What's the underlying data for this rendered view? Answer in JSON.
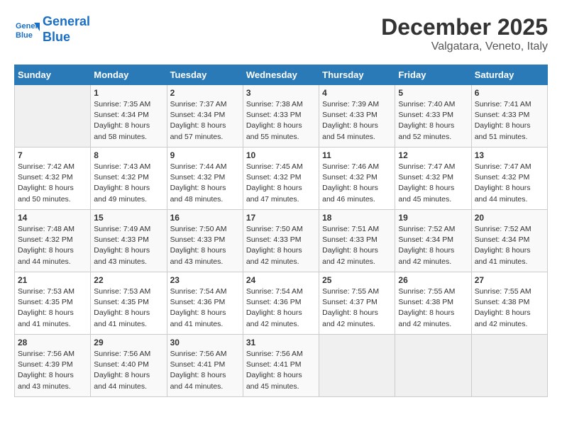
{
  "header": {
    "logo_line1": "General",
    "logo_line2": "Blue",
    "month": "December 2025",
    "location": "Valgatara, Veneto, Italy"
  },
  "weekdays": [
    "Sunday",
    "Monday",
    "Tuesday",
    "Wednesday",
    "Thursday",
    "Friday",
    "Saturday"
  ],
  "weeks": [
    [
      {
        "day": "",
        "sunrise": "",
        "sunset": "",
        "daylight": ""
      },
      {
        "day": "1",
        "sunrise": "Sunrise: 7:35 AM",
        "sunset": "Sunset: 4:34 PM",
        "daylight": "Daylight: 8 hours and 58 minutes."
      },
      {
        "day": "2",
        "sunrise": "Sunrise: 7:37 AM",
        "sunset": "Sunset: 4:34 PM",
        "daylight": "Daylight: 8 hours and 57 minutes."
      },
      {
        "day": "3",
        "sunrise": "Sunrise: 7:38 AM",
        "sunset": "Sunset: 4:33 PM",
        "daylight": "Daylight: 8 hours and 55 minutes."
      },
      {
        "day": "4",
        "sunrise": "Sunrise: 7:39 AM",
        "sunset": "Sunset: 4:33 PM",
        "daylight": "Daylight: 8 hours and 54 minutes."
      },
      {
        "day": "5",
        "sunrise": "Sunrise: 7:40 AM",
        "sunset": "Sunset: 4:33 PM",
        "daylight": "Daylight: 8 hours and 52 minutes."
      },
      {
        "day": "6",
        "sunrise": "Sunrise: 7:41 AM",
        "sunset": "Sunset: 4:33 PM",
        "daylight": "Daylight: 8 hours and 51 minutes."
      }
    ],
    [
      {
        "day": "7",
        "sunrise": "Sunrise: 7:42 AM",
        "sunset": "Sunset: 4:32 PM",
        "daylight": "Daylight: 8 hours and 50 minutes."
      },
      {
        "day": "8",
        "sunrise": "Sunrise: 7:43 AM",
        "sunset": "Sunset: 4:32 PM",
        "daylight": "Daylight: 8 hours and 49 minutes."
      },
      {
        "day": "9",
        "sunrise": "Sunrise: 7:44 AM",
        "sunset": "Sunset: 4:32 PM",
        "daylight": "Daylight: 8 hours and 48 minutes."
      },
      {
        "day": "10",
        "sunrise": "Sunrise: 7:45 AM",
        "sunset": "Sunset: 4:32 PM",
        "daylight": "Daylight: 8 hours and 47 minutes."
      },
      {
        "day": "11",
        "sunrise": "Sunrise: 7:46 AM",
        "sunset": "Sunset: 4:32 PM",
        "daylight": "Daylight: 8 hours and 46 minutes."
      },
      {
        "day": "12",
        "sunrise": "Sunrise: 7:47 AM",
        "sunset": "Sunset: 4:32 PM",
        "daylight": "Daylight: 8 hours and 45 minutes."
      },
      {
        "day": "13",
        "sunrise": "Sunrise: 7:47 AM",
        "sunset": "Sunset: 4:32 PM",
        "daylight": "Daylight: 8 hours and 44 minutes."
      }
    ],
    [
      {
        "day": "14",
        "sunrise": "Sunrise: 7:48 AM",
        "sunset": "Sunset: 4:32 PM",
        "daylight": "Daylight: 8 hours and 44 minutes."
      },
      {
        "day": "15",
        "sunrise": "Sunrise: 7:49 AM",
        "sunset": "Sunset: 4:33 PM",
        "daylight": "Daylight: 8 hours and 43 minutes."
      },
      {
        "day": "16",
        "sunrise": "Sunrise: 7:50 AM",
        "sunset": "Sunset: 4:33 PM",
        "daylight": "Daylight: 8 hours and 43 minutes."
      },
      {
        "day": "17",
        "sunrise": "Sunrise: 7:50 AM",
        "sunset": "Sunset: 4:33 PM",
        "daylight": "Daylight: 8 hours and 42 minutes."
      },
      {
        "day": "18",
        "sunrise": "Sunrise: 7:51 AM",
        "sunset": "Sunset: 4:33 PM",
        "daylight": "Daylight: 8 hours and 42 minutes."
      },
      {
        "day": "19",
        "sunrise": "Sunrise: 7:52 AM",
        "sunset": "Sunset: 4:34 PM",
        "daylight": "Daylight: 8 hours and 42 minutes."
      },
      {
        "day": "20",
        "sunrise": "Sunrise: 7:52 AM",
        "sunset": "Sunset: 4:34 PM",
        "daylight": "Daylight: 8 hours and 41 minutes."
      }
    ],
    [
      {
        "day": "21",
        "sunrise": "Sunrise: 7:53 AM",
        "sunset": "Sunset: 4:35 PM",
        "daylight": "Daylight: 8 hours and 41 minutes."
      },
      {
        "day": "22",
        "sunrise": "Sunrise: 7:53 AM",
        "sunset": "Sunset: 4:35 PM",
        "daylight": "Daylight: 8 hours and 41 minutes."
      },
      {
        "day": "23",
        "sunrise": "Sunrise: 7:54 AM",
        "sunset": "Sunset: 4:36 PM",
        "daylight": "Daylight: 8 hours and 41 minutes."
      },
      {
        "day": "24",
        "sunrise": "Sunrise: 7:54 AM",
        "sunset": "Sunset: 4:36 PM",
        "daylight": "Daylight: 8 hours and 42 minutes."
      },
      {
        "day": "25",
        "sunrise": "Sunrise: 7:55 AM",
        "sunset": "Sunset: 4:37 PM",
        "daylight": "Daylight: 8 hours and 42 minutes."
      },
      {
        "day": "26",
        "sunrise": "Sunrise: 7:55 AM",
        "sunset": "Sunset: 4:38 PM",
        "daylight": "Daylight: 8 hours and 42 minutes."
      },
      {
        "day": "27",
        "sunrise": "Sunrise: 7:55 AM",
        "sunset": "Sunset: 4:38 PM",
        "daylight": "Daylight: 8 hours and 42 minutes."
      }
    ],
    [
      {
        "day": "28",
        "sunrise": "Sunrise: 7:56 AM",
        "sunset": "Sunset: 4:39 PM",
        "daylight": "Daylight: 8 hours and 43 minutes."
      },
      {
        "day": "29",
        "sunrise": "Sunrise: 7:56 AM",
        "sunset": "Sunset: 4:40 PM",
        "daylight": "Daylight: 8 hours and 44 minutes."
      },
      {
        "day": "30",
        "sunrise": "Sunrise: 7:56 AM",
        "sunset": "Sunset: 4:41 PM",
        "daylight": "Daylight: 8 hours and 44 minutes."
      },
      {
        "day": "31",
        "sunrise": "Sunrise: 7:56 AM",
        "sunset": "Sunset: 4:41 PM",
        "daylight": "Daylight: 8 hours and 45 minutes."
      },
      {
        "day": "",
        "sunrise": "",
        "sunset": "",
        "daylight": ""
      },
      {
        "day": "",
        "sunrise": "",
        "sunset": "",
        "daylight": ""
      },
      {
        "day": "",
        "sunrise": "",
        "sunset": "",
        "daylight": ""
      }
    ]
  ]
}
